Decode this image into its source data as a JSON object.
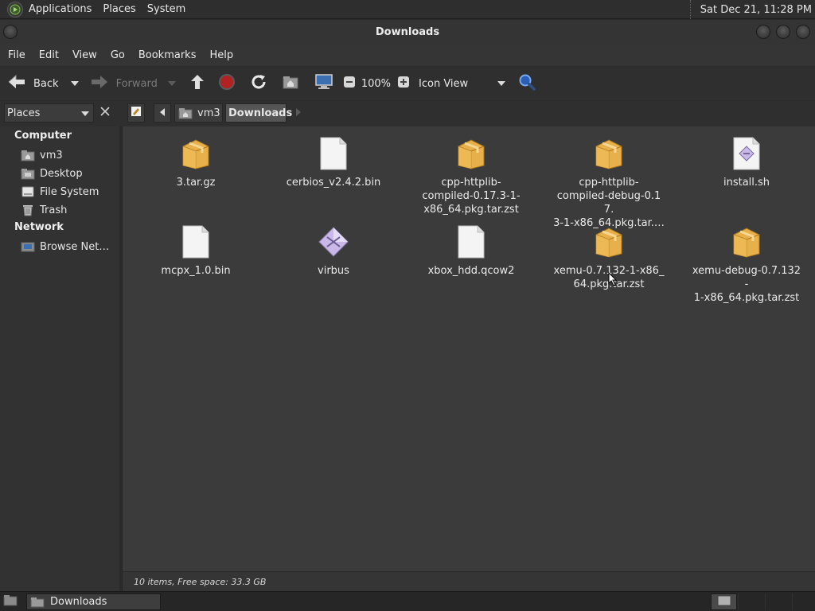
{
  "top_panel": {
    "menus": [
      "Applications",
      "Places",
      "System"
    ],
    "clock": "Sat Dec 21, 11:28 PM"
  },
  "window": {
    "title": "Downloads"
  },
  "menubar": [
    "File",
    "Edit",
    "View",
    "Go",
    "Bookmarks",
    "Help"
  ],
  "toolbar": {
    "back_label": "Back",
    "forward_label": "Forward",
    "zoom": "100%",
    "view_mode": "Icon View"
  },
  "locationbar": {
    "pane_selector": "Places",
    "crumbs": [
      "vm3",
      "Downloads"
    ]
  },
  "sidebar": {
    "sections": [
      {
        "heading": "Computer",
        "items": [
          "vm3",
          "Desktop",
          "File System",
          "Trash"
        ]
      },
      {
        "heading": "Network",
        "items": [
          "Browse Net…"
        ]
      }
    ]
  },
  "files": [
    {
      "name": "3.tar.gz",
      "icon": "package-icon"
    },
    {
      "name": "cerbios_v2.4.2.bin",
      "icon": "blank-file-icon"
    },
    {
      "name": "cpp-httplib-compiled-0.17.3-1-x86_64.pkg.tar.zst",
      "icon": "package-icon"
    },
    {
      "name": "cpp-httplib-compiled-debug-0.17.3-1-x86_64.pkg.tar.…",
      "icon": "package-icon"
    },
    {
      "name": "install.sh",
      "icon": "script-file-icon"
    },
    {
      "name": "mcpx_1.0.bin",
      "icon": "blank-file-icon"
    },
    {
      "name": "virbus",
      "icon": "executable-icon"
    },
    {
      "name": "xbox_hdd.qcow2",
      "icon": "blank-file-icon"
    },
    {
      "name": "xemu-0.7.132-1-x86_64.pkg.tar.zst",
      "icon": "package-icon"
    },
    {
      "name": "xemu-debug-0.7.132-1-x86_64.pkg.tar.zst",
      "icon": "package-icon"
    }
  ],
  "file_label_lines": [
    [
      "3.tar.gz"
    ],
    [
      "cerbios_v2.4.2.bin"
    ],
    [
      "cpp-httplib-",
      "compiled-0.17.3-1-",
      "x86_64.pkg.tar.zst"
    ],
    [
      "cpp-httplib-",
      "compiled-debug-0.17.",
      "3-1-x86_64.pkg.tar.…"
    ],
    [
      "install.sh"
    ],
    [
      "mcpx_1.0.bin"
    ],
    [
      "virbus"
    ],
    [
      "xbox_hdd.qcow2"
    ],
    [
      "xemu-0.7.132-1-x86_",
      "64.pkg.tar.zst"
    ],
    [
      "xemu-debug-0.7.132-",
      "1-x86_64.pkg.tar.zst"
    ]
  ],
  "status": "10 items, Free space: 33.3 GB",
  "taskbar": {
    "task_label": "Downloads"
  },
  "colors": {
    "folder": "#e8b04a",
    "background": "#3b3b3b",
    "panel": "#2e2e2e"
  }
}
